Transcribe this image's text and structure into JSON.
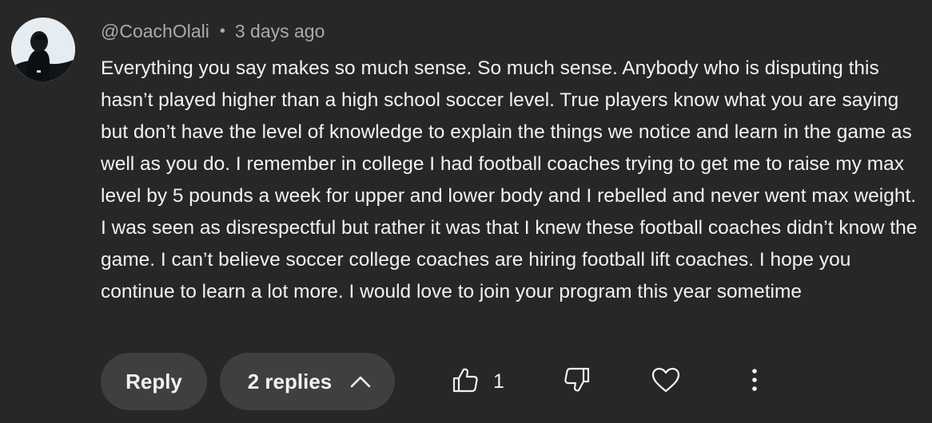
{
  "comment": {
    "author": "@CoachOlali",
    "separator": "•",
    "time": "3 days ago",
    "text": "Everything you say makes so much sense. So much sense. Anybody who is disputing this hasn’t played higher than a high school soccer level. True players know what you are saying but don’t have the level of knowledge to explain the things we notice and learn in the game as well as you do. I remember in college I had football coaches trying to get me to raise my max level by 5 pounds a week for upper and lower body and I rebelled and never went max weight. I was seen as disrespectful but rather it was that I knew these football coaches didn’t know the game. I can’t believe soccer college coaches are hiring football lift coaches. I hope you continue to learn a lot more. I would love to join your program this year sometime"
  },
  "actions": {
    "reply_label": "Reply",
    "replies_label": "2 replies",
    "replies_icon": "chevron-up-icon",
    "like_icon": "thumbs-up-icon",
    "like_count": "1",
    "dislike_icon": "thumbs-down-icon",
    "heart_icon": "heart-icon",
    "more_icon": "more-vertical-icon"
  },
  "colors": {
    "background": "#272727",
    "button_background": "#3f3f3f",
    "primary_text": "#f1f1f1",
    "secondary_text": "#aaaaaa"
  }
}
